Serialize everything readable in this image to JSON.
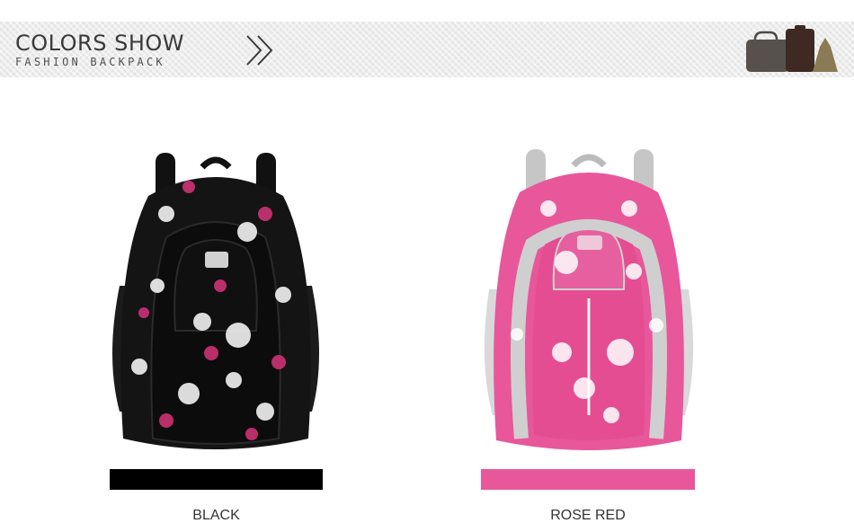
{
  "banner": {
    "title": "COLORS SHOW",
    "subtitle": "FASHION BACKPACK"
  },
  "icons": {
    "arrow": "double-chevron-right-icon",
    "bags": "bags-silhouette-icon"
  },
  "products": [
    {
      "name": "BLACK",
      "swatch_color": "#000000",
      "image": "black-floral-backpack"
    },
    {
      "name": "ROSE RED",
      "swatch_color": "#e8579a",
      "image": "rose-red-floral-backpack"
    }
  ]
}
